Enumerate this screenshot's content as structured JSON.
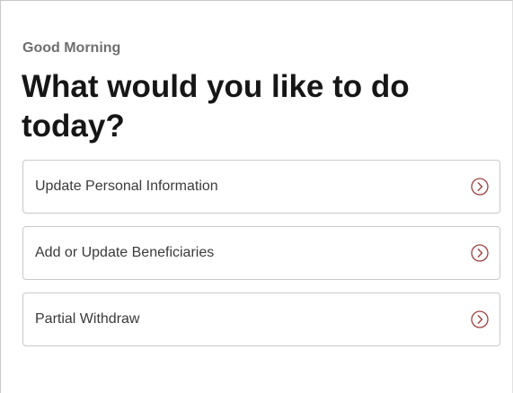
{
  "greeting": "Good Morning",
  "headline": "What would you like to do today?",
  "actions": [
    {
      "label": "Update Personal Information",
      "icon": "chevron-right-circle-icon"
    },
    {
      "label": "Add or Update Beneficiaries",
      "icon": "chevron-right-circle-icon"
    },
    {
      "label": "Partial Withdraw",
      "icon": "chevron-right-circle-icon"
    }
  ],
  "colors": {
    "accent": "#a04040",
    "heading": "#161616",
    "greeting": "#6f6f6f",
    "border": "#c9c9c9"
  }
}
